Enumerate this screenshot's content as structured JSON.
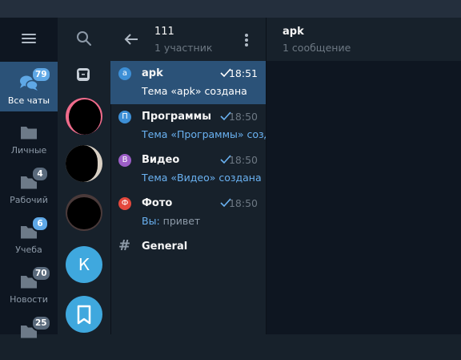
{
  "colors": {
    "accent": "#5fa8e6",
    "active_bg": "#2b5278",
    "rail_bg": "#0e1621",
    "panel_bg": "#17212b"
  },
  "rail": {
    "menu_icon": "hamburger-icon",
    "folders": [
      {
        "label": "Все чаты",
        "badge": "79",
        "icon": "chat-bubbles-icon",
        "active": true
      },
      {
        "label": "Личные",
        "badge": "",
        "icon": "folder-icon"
      },
      {
        "label": "Рабочий",
        "badge": "4",
        "icon": "folder-icon"
      },
      {
        "label": "Учеба",
        "badge": "6",
        "icon": "folder-icon"
      },
      {
        "label": "Новости",
        "badge": "70",
        "icon": "folder-icon"
      },
      {
        "label": "",
        "badge": "25",
        "icon": "folder-icon"
      }
    ]
  },
  "forum_column": {
    "search_icon": "search-icon",
    "archive_icon": "archive-icon",
    "k_avatar_letter": "К",
    "saved_icon": "bookmark-icon"
  },
  "topic_list": {
    "title": "111",
    "subtitle": "1 участник",
    "topics": [
      {
        "icon_letter": "а",
        "icon_color": "#3d8fd6",
        "name": "apk",
        "time": "18:51",
        "preview": "Тема «apk» создана",
        "active": true
      },
      {
        "icon_letter": "П",
        "icon_color": "#3d8fd6",
        "name": "Программы",
        "time": "18:50",
        "preview": "Тема «Программы» создана"
      },
      {
        "icon_letter": "В",
        "icon_color": "#9c5ec7",
        "name": "Видео",
        "time": "18:50",
        "preview": "Тема «Видео» создана"
      },
      {
        "icon_letter": "Ф",
        "icon_color": "#e3483d",
        "name": "Фото",
        "time": "18:50",
        "preview_sender": "Вы:",
        "preview": "привет"
      },
      {
        "name": "General",
        "hash": "#"
      }
    ]
  },
  "chat": {
    "title": "apk",
    "subtitle": "1 сообщение"
  }
}
